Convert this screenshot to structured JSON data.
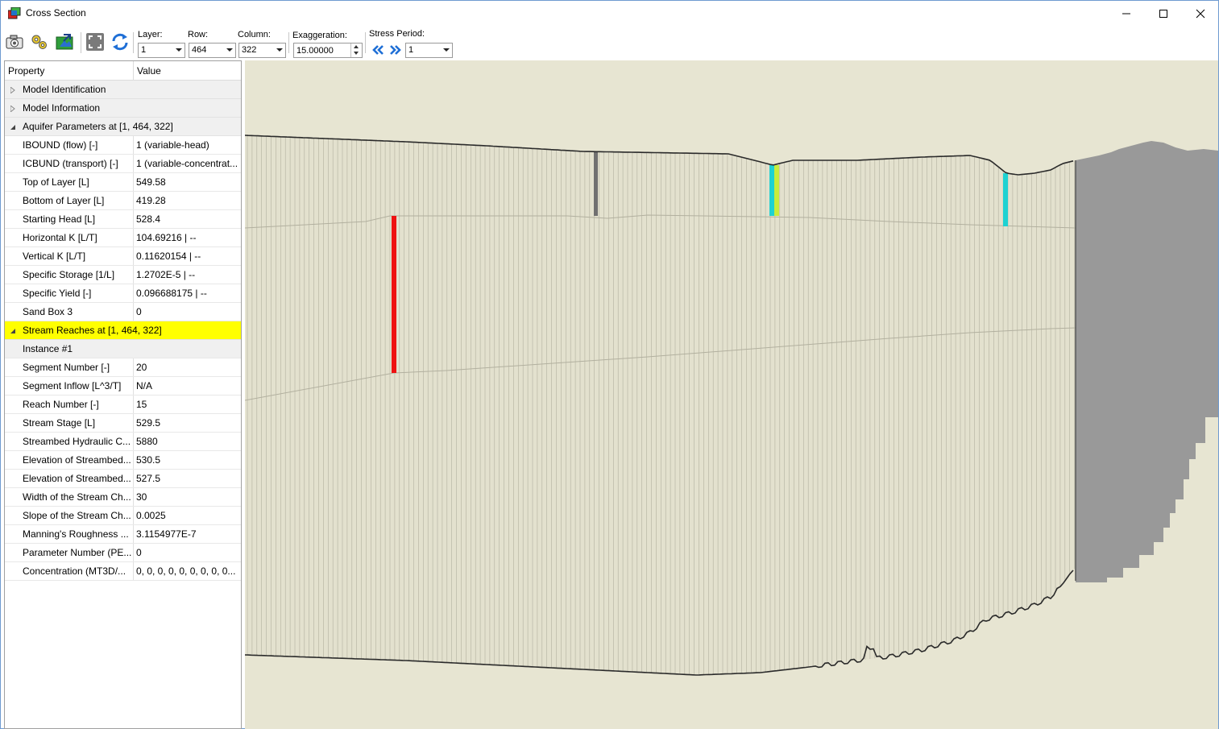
{
  "window": {
    "title": "Cross Section",
    "controls": {
      "minimize": "minimize",
      "maximize": "maximize",
      "close": "close"
    }
  },
  "toolbar": {
    "buttons": [
      "camera-icon",
      "settings-gears-icon",
      "export-image-icon",
      "fit-view-icon",
      "refresh-icon"
    ],
    "layer": {
      "label": "Layer:",
      "value": "1"
    },
    "row": {
      "label": "Row:",
      "value": "464"
    },
    "column": {
      "label": "Column:",
      "value": "322"
    },
    "exaggeration": {
      "label": "Exaggeration:",
      "value": "15.00000"
    },
    "stress_period": {
      "label": "Stress Period:",
      "value": "1",
      "prev": "«",
      "next": "»"
    }
  },
  "property_grid": {
    "header": {
      "property": "Property",
      "value": "Value"
    },
    "categories": {
      "model_identification": "Model Identification",
      "model_information": "Model Information",
      "aquifer_parameters": "Aquifer Parameters at [1, 464, 322]",
      "stream_reaches": "Stream Reaches at [1, 464, 322]"
    },
    "aquifer_rows": [
      {
        "name": "IBOUND (flow) [-]",
        "value": "1 (variable-head)"
      },
      {
        "name": "ICBUND (transport) [-]",
        "value": "1 (variable-concentrat..."
      },
      {
        "name": "Top of Layer [L]",
        "value": "549.58"
      },
      {
        "name": "Bottom of Layer [L]",
        "value": "419.28"
      },
      {
        "name": "Starting Head [L]",
        "value": "528.4"
      },
      {
        "name": "Horizontal K [L/T]",
        "value": "104.69216 | --"
      },
      {
        "name": "Vertical K [L/T]",
        "value": "0.11620154 | --"
      },
      {
        "name": "Specific Storage [1/L]",
        "value": "1.2702E-5 | --"
      },
      {
        "name": "Specific Yield [-]",
        "value": "0.096688175 | --"
      },
      {
        "name": "Sand Box 3",
        "value": "0"
      }
    ],
    "instance_label": "Instance #1",
    "stream_rows": [
      {
        "name": "Segment Number [-]",
        "value": "20"
      },
      {
        "name": "Segment Inflow [L^3/T]",
        "value": "N/A"
      },
      {
        "name": "Reach Number [-]",
        "value": "15"
      },
      {
        "name": "Stream Stage [L]",
        "value": "529.5"
      },
      {
        "name": "Streambed Hydraulic C...",
        "value": "5880"
      },
      {
        "name": "Elevation of Streambed...",
        "value": "530.5"
      },
      {
        "name": "Elevation of Streambed...",
        "value": "527.5"
      },
      {
        "name": "Width of the Stream Ch...",
        "value": "30"
      },
      {
        "name": "Slope of the Stream Ch...",
        "value": "0.0025"
      },
      {
        "name": "Manning's Roughness ...",
        "value": "3.1154977E-7"
      },
      {
        "name": "Parameter Number (PE...",
        "value": "0"
      },
      {
        "name": "Concentration (MT3D/...",
        "value": "0, 0, 0, 0, 0, 0, 0, 0, 0..."
      }
    ]
  },
  "colors": {
    "background": "#e7e5d2",
    "cells": "#e3e1ce",
    "grid": "#b2b09f",
    "inactive": "#999999",
    "selected_cell": "#ee1111",
    "stream": "#1ed2d2",
    "stream_alt": "#c8ec3c",
    "well": "#707070",
    "highlight": "#ffff00"
  }
}
